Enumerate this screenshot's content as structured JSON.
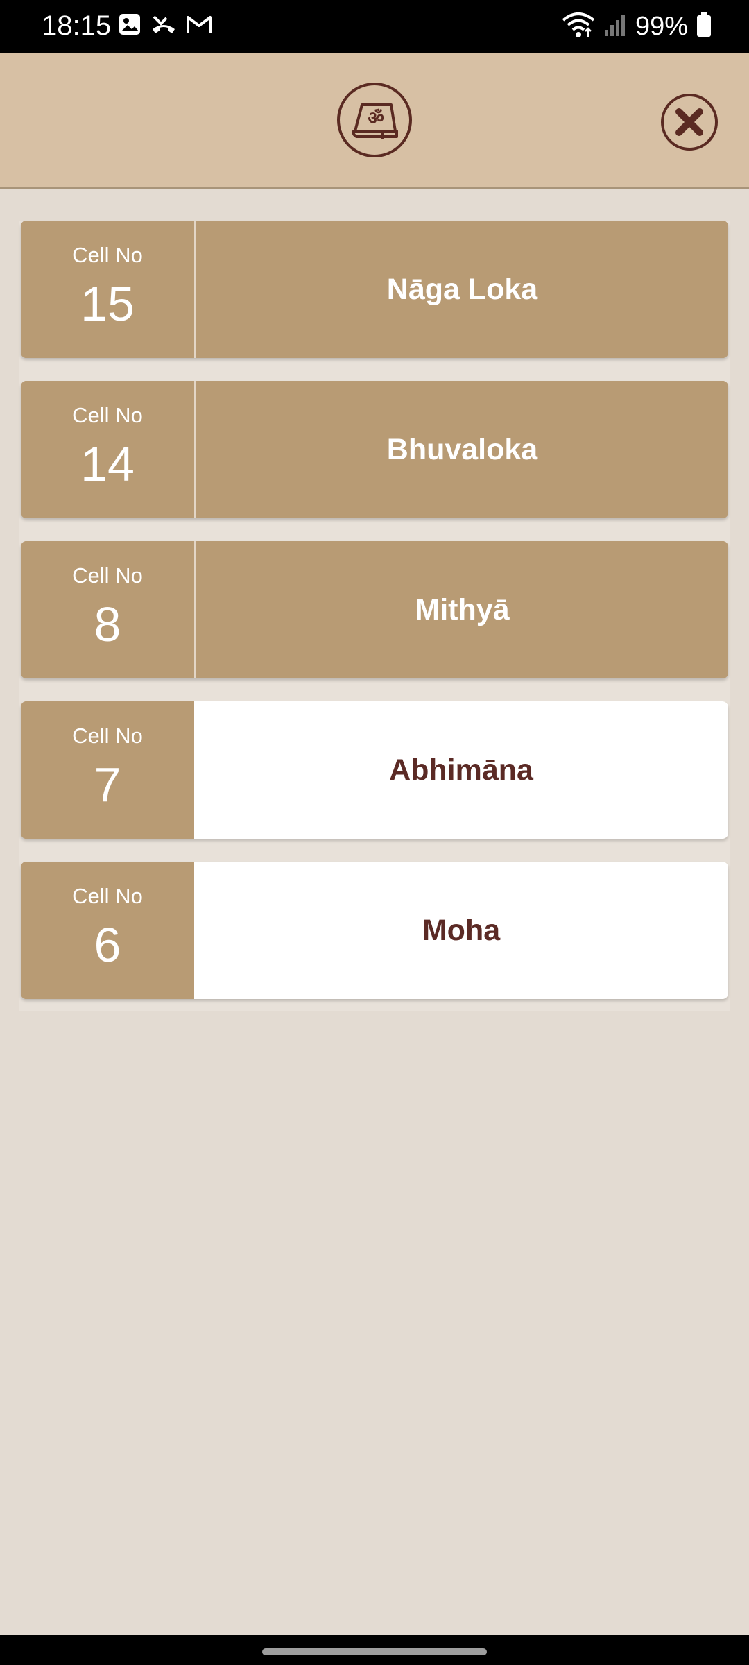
{
  "status_bar": {
    "time": "18:15",
    "battery": "99%",
    "left_icons": [
      "gallery-icon",
      "missed-call-icon",
      "gmail-icon"
    ],
    "right_icons": [
      "wifi-icon",
      "signal-icon",
      "battery-icon"
    ]
  },
  "header": {
    "logo_icon": "om-book-icon",
    "close_icon": "close-icon"
  },
  "cards": [
    {
      "cell_label": "Cell No",
      "cell_number": "15",
      "name": "Nāga Loka",
      "style": "tan"
    },
    {
      "cell_label": "Cell No",
      "cell_number": "14",
      "name": "Bhuvaloka",
      "style": "tan"
    },
    {
      "cell_label": "Cell No",
      "cell_number": "8",
      "name": "Mithyā",
      "style": "tan"
    },
    {
      "cell_label": "Cell No",
      "cell_number": "7",
      "name": "Abhimāna",
      "style": "white"
    },
    {
      "cell_label": "Cell No",
      "cell_number": "6",
      "name": "Moha",
      "style": "white"
    }
  ],
  "colors": {
    "background": "#e3dbd2",
    "header": "#d7c0a4",
    "card_tan": "#b89b74",
    "card_white": "#ffffff",
    "accent_dark": "#5b2a25"
  }
}
